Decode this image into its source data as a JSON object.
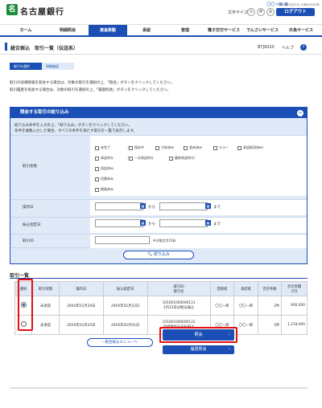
{
  "header": {
    "brand": "名古屋銀行",
    "user": "〇〇一郎 様",
    "last_login": "20XX年01月20日 10時00分00秒",
    "font_size_label": "文字サイズ",
    "font_small": "小",
    "font_mid": "中",
    "font_large": "大",
    "logout": "ログアウト"
  },
  "nav": [
    "ホーム",
    "明細照会",
    "資金移動",
    "承認",
    "管理",
    "電子交付サービス",
    "でんさいサービス",
    "外為サービス"
  ],
  "page": {
    "title": "総合振込　取引一覧（伝送系）",
    "screen_id": "BTJS020",
    "help": "ヘルプ"
  },
  "steps": [
    "取引を選択",
    "明細確認"
  ],
  "desc": [
    "取引の詳細情報を照会する場合は、対象の取引を選択の上、「照会」ボタンをクリックしてください。",
    "取引履歴を照会する場合は、対象の取引を選択の上、「履歴照会」ボタンをクリックしてください。"
  ],
  "filter": {
    "title": "照会する取引の絞り込み",
    "desc1": "絞り込み条件を入力の上、「絞り込み」ボタンをクリックしてください。",
    "desc2": "条件を複数入力した場合、すべての条件を満たす取引を一覧で表示します。",
    "status_label": "取引状態",
    "statuses": [
      "未完了",
      "保存中",
      "引戻済み",
      "差戻済み",
      "エラー",
      "承認取消済み",
      "承認待ち",
      "一次承認待ち",
      "最終承認待ち",
      "承認済み",
      "切替済み",
      "期限済み"
    ],
    "operation_date_label": "操作日",
    "transfer_date_label": "振込指定日",
    "from": "から",
    "to": "まで",
    "id_label": "取引ID",
    "id_hint": "※半角文字15桁",
    "search": "絞り込み"
  },
  "list": {
    "title": "取引一覧",
    "headers": [
      "選択",
      "取引状態",
      "操作日",
      "振込指定日",
      "取引ID\n取引名",
      "登録者",
      "承認者",
      "合計件数",
      "合計金額\n(円)"
    ],
    "rows": [
      [
        "未承認",
        "20XX年01月20日",
        "20XX年01月22日",
        "101001000000121",
        "1月22日分給与振込",
        "〇〇一郎",
        "〇〇一郎",
        "2件",
        "900,000"
      ],
      [
        "未承認",
        "20XX年01月20日",
        "20XX年02月01日",
        "101001000000122",
        "月初締め分支払振込",
        "〇〇一郎",
        "〇〇一郎",
        "5件",
        "1,218,000"
      ]
    ]
  },
  "buttons": {
    "back": "総合振込メニューへ",
    "inquiry": "照会",
    "history": "履歴照会"
  }
}
